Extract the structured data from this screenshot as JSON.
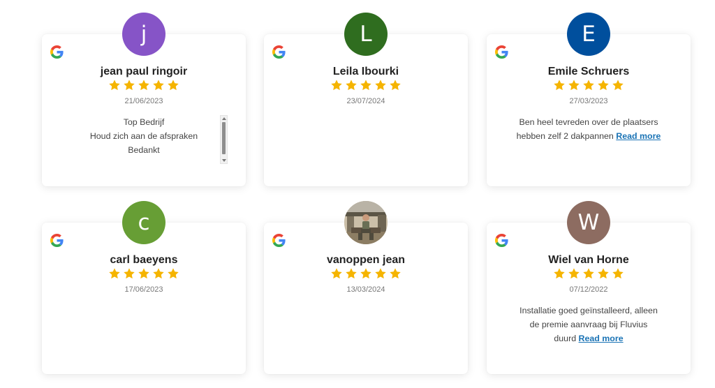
{
  "colors": {
    "star": "#f5b400",
    "read_more": "#1a73b5",
    "avatar_j": "#8654c7",
    "avatar_l": "#2f6d1f",
    "avatar_e": "#004f9d",
    "avatar_c": "#679e35",
    "avatar_w": "#8d6c61"
  },
  "icons": {
    "platform": "google-icon",
    "rating": "star-icon"
  },
  "reviews": [
    {
      "avatar_letter": "j",
      "avatar_color": "#8654c7",
      "name": "jean paul ringoir",
      "rating": 5,
      "date": "21/06/2023",
      "text_lines": [
        "Top Bedrijf",
        "Houd zich aan de afspraken",
        "Bedankt"
      ],
      "has_scrollbar": true
    },
    {
      "avatar_letter": "L",
      "avatar_color": "#2f6d1f",
      "name": "Leila Ibourki",
      "rating": 5,
      "date": "23/07/2024",
      "text_lines": []
    },
    {
      "avatar_letter": "E",
      "avatar_color": "#004f9d",
      "name": "Emile Schruers",
      "rating": 5,
      "date": "27/03/2023",
      "text_lines": [
        "Ben heel tevreden over de plaatsers",
        "hebben zelf 2 dakpannen"
      ],
      "read_more": "Read more"
    },
    {
      "avatar_letter": "c",
      "avatar_color": "#679e35",
      "name": "carl baeyens",
      "rating": 5,
      "date": "17/06/2023",
      "text_lines": []
    },
    {
      "avatar_letter": "",
      "avatar_photo": "user-photo",
      "name": "vanoppen jean",
      "rating": 5,
      "date": "13/03/2024",
      "text_lines": []
    },
    {
      "avatar_letter": "W",
      "avatar_color": "#8d6c61",
      "name": "Wiel van Horne",
      "rating": 5,
      "date": "07/12/2022",
      "text_lines": [
        "Installatie goed geïnstalleerd, alleen",
        "de premie aanvraag bij Fluvius",
        "duurd"
      ],
      "read_more": "Read more"
    }
  ]
}
